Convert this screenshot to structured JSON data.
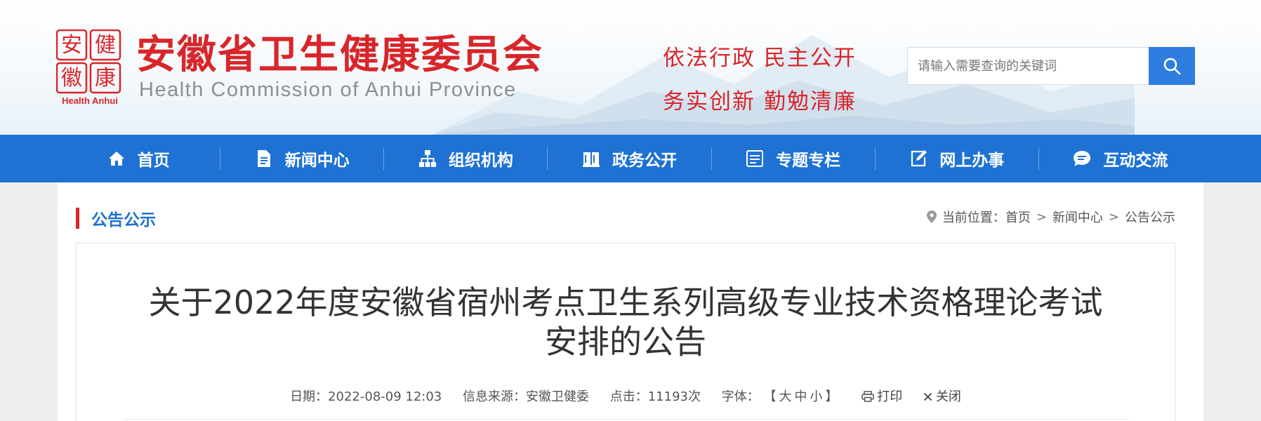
{
  "header": {
    "logo_chars": [
      "安",
      "健",
      "徽",
      "康"
    ],
    "logo_tag": "Health Anhui",
    "title": "安徽省卫生健康委员会",
    "subtitle": "Health Commission of Anhui Province",
    "slogan_line1": "依法行政 民主公开",
    "slogan_line2": "务实创新 勤勉清廉",
    "search_placeholder": "请输入需要查询的关键词"
  },
  "nav": [
    {
      "label": "首页",
      "icon": "home-icon"
    },
    {
      "label": "新闻中心",
      "icon": "document-icon"
    },
    {
      "label": "组织机构",
      "icon": "org-chart-icon"
    },
    {
      "label": "政务公开",
      "icon": "book-icon"
    },
    {
      "label": "专题专栏",
      "icon": "list-icon"
    },
    {
      "label": "网上办事",
      "icon": "edit-icon"
    },
    {
      "label": "互动交流",
      "icon": "chat-icon"
    }
  ],
  "section": {
    "title": "公告公示"
  },
  "breadcrumb": {
    "prefix": "当前位置：",
    "items": [
      "首页",
      "新闻中心",
      "公告公示"
    ]
  },
  "article": {
    "title_line1": "关于2022年度安徽省宿州考点卫生系列高级专业技术资格理论考试",
    "title_line2": "安排的公告",
    "date": "日期：2022-08-09 12:03",
    "source": "信息来源：安徽卫健委",
    "clicks": "点击：11193次",
    "font_label": "字体：",
    "font_open": "【",
    "font_big": "大",
    "font_mid": "中",
    "font_small": "小",
    "font_close": "】",
    "print": "打印",
    "close": "关闭"
  },
  "colors": {
    "brand_red": "#d8262a",
    "nav_blue": "#1f72d3",
    "search_blue": "#2e7de0"
  }
}
